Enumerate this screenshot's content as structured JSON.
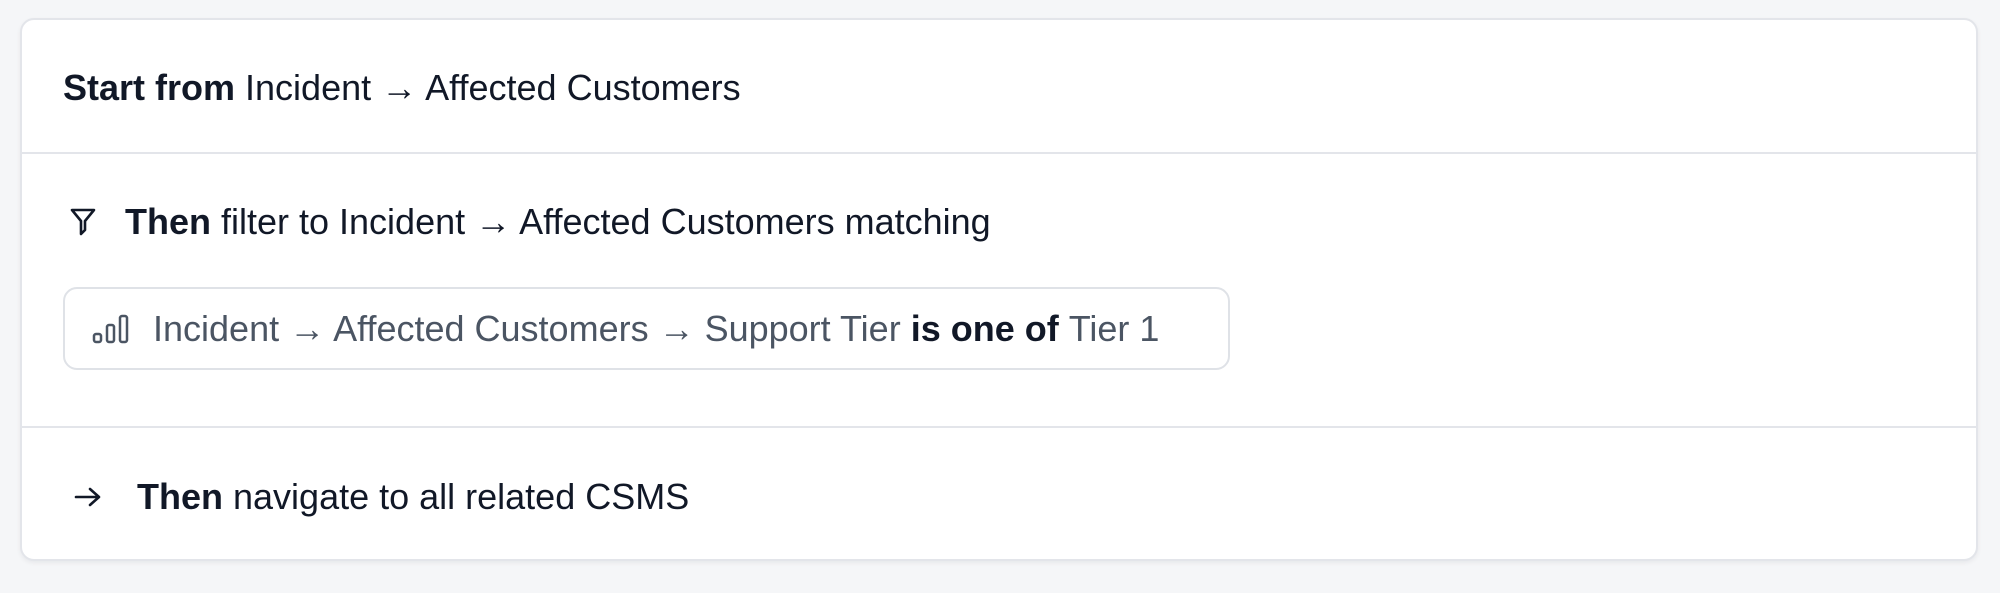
{
  "start": {
    "keyword": "Start from",
    "path": "Incident → Affected Customers"
  },
  "filter": {
    "keyword": "Then",
    "text": "filter to Incident → Affected Customers matching",
    "icon": "filter-icon",
    "condition": {
      "icon": "bar-chart-icon",
      "field": "Incident → Affected Customers → Support Tier",
      "operator": "is one of",
      "value": "Tier 1"
    }
  },
  "navigate": {
    "keyword": "Then",
    "text": "navigate to all related CSMS",
    "icon": "arrow-right-icon"
  },
  "colors": {
    "background": "#f5f6f8",
    "card": "#ffffff",
    "border": "#e3e5ea",
    "text_primary": "#111827",
    "text_secondary": "#4b5563"
  }
}
